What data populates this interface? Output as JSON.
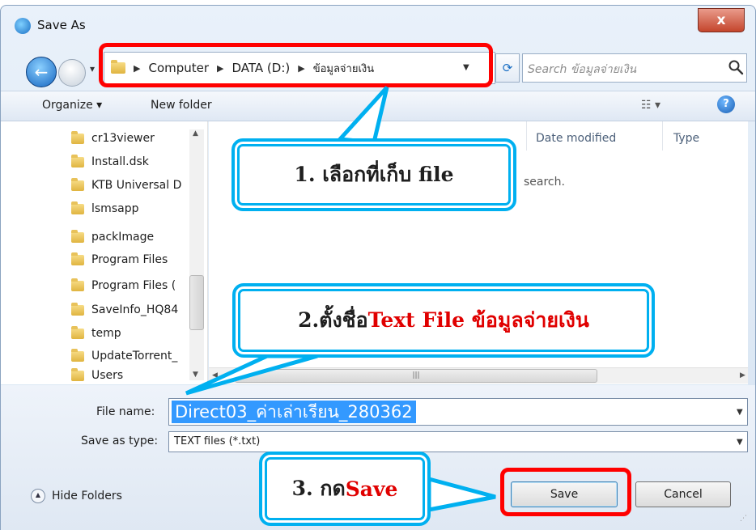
{
  "window": {
    "title": "Save As",
    "close_label": "x"
  },
  "address": {
    "crumbs": [
      "Computer",
      "DATA (D:)",
      "ข้อมูลจ่ายเงิน"
    ]
  },
  "search": {
    "placeholder": "Search ข้อมูลจ่ายเงิน"
  },
  "toolbar": {
    "organize_label": "Organize ▾",
    "new_folder_label": "New folder"
  },
  "nav_tree": {
    "items": [
      "cr13viewer",
      "Install.dsk",
      "KTB Universal D",
      "lsmsapp",
      "packImage",
      "Program Files",
      "Program Files (",
      "SaveInfo_HQ84",
      "temp",
      "UpdateTorrent_",
      "Users"
    ]
  },
  "file_list": {
    "columns": [
      "Date modified",
      "Type"
    ],
    "empty_message": "search."
  },
  "form": {
    "file_name_label": "File name:",
    "file_name_value": "Direct03_ค่าเล่าเรียน_280362",
    "save_type_label": "Save as type:",
    "save_type_value": "TEXT files (*.txt)"
  },
  "footer": {
    "hide_folders_label": "Hide Folders",
    "save_label": "Save",
    "cancel_label": "Cancel"
  },
  "annotations": {
    "step1": "1. เลือกที่เก็บ file",
    "step2_prefix": "2.ตั้งชื่อ ",
    "step2_highlight": "Text File ข้อมูลจ่ายเงิน",
    "step3_prefix": "3. กด ",
    "step3_highlight": "Save",
    "highlight_color": "#ff0000",
    "callout_color": "#00b0f0"
  }
}
